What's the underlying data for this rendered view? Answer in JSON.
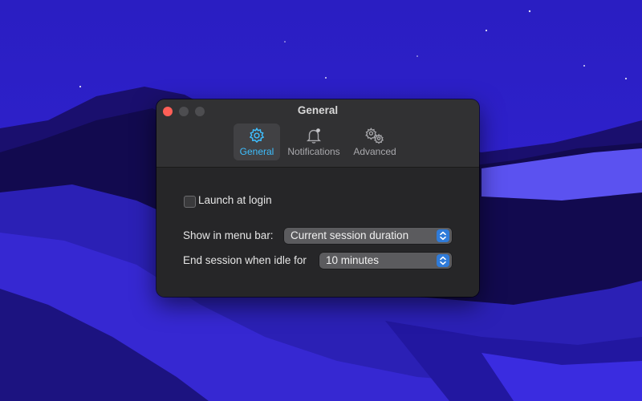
{
  "window": {
    "title": "General"
  },
  "toolbar": {
    "tabs": [
      {
        "label": "General",
        "icon": "gear-icon",
        "selected": true
      },
      {
        "label": "Notifications",
        "icon": "bell-icon",
        "selected": false
      },
      {
        "label": "Advanced",
        "icon": "gears-icon",
        "selected": false
      }
    ]
  },
  "settings": {
    "launch_at_login": {
      "label": "Launch at login",
      "checked": false
    },
    "menu_bar": {
      "label": "Show in menu bar:",
      "value": "Current session duration"
    },
    "idle": {
      "label": "End session when idle for",
      "value": "10 minutes"
    }
  },
  "colors": {
    "accent": "#3ebfff",
    "close": "#ff5f57",
    "popup_stepper": "#2f7bd9",
    "window_bg": "#262628"
  }
}
